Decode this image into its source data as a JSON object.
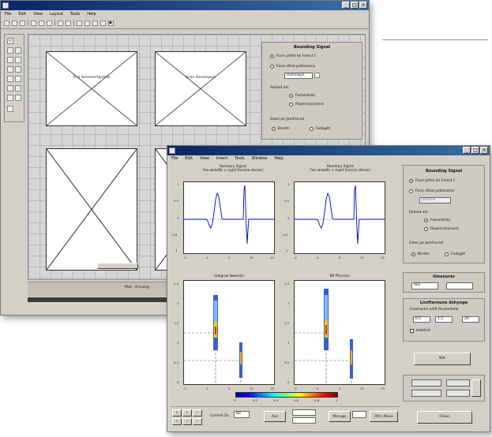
{
  "guide": {
    "window_title": "",
    "menu": [
      "File",
      "Edit",
      "View",
      "Layout",
      "Tools",
      "Help"
    ],
    "axes": [
      {
        "label": "Frst Scheme/Update"
      },
      {
        "label": "Scen Sonsarpe/s"
      },
      {
        "label": ""
      },
      {
        "label": ""
      }
    ],
    "panel": {
      "title": "Bounding Signal",
      "opt1": "Fone pitfot tei Femct f",
      "opt2": "Fone sltrot pstheroms",
      "edit": "Hutmiepit",
      "section": "Reload ein",
      "opt3": "Fomerdrsts",
      "opt4": "Repennaroment",
      "section2": "Gden pe Jemfrecnd",
      "opt5": "Bredm",
      "opt6": "Fedoght"
    },
    "status": "Mat - Arccong"
  },
  "fig": {
    "window_title": "",
    "menu": [
      "File",
      "Edit",
      "View",
      "Insert",
      "Tools",
      "Window",
      "Help"
    ],
    "plots": [
      {
        "title": "Ronntary Signal",
        "subtitle": "Fee oIntaffe + mplit Fecv(m sferrer)",
        "xticks": [
          "-5",
          "0",
          "5",
          "10",
          "15"
        ],
        "yticks": [
          "1",
          "0.5",
          "0",
          "-0.5",
          "-1"
        ]
      },
      {
        "title": "Ronntary Signal",
        "subtitle": "Fee oIntaffe + mplit Fecv(m sferrer)",
        "xticks": [
          "-5",
          "0",
          "5",
          "10",
          "15"
        ],
        "yticks": [
          "1",
          "0.5",
          "0",
          "-0.5",
          "-1"
        ]
      },
      {
        "title": "Udegrae Neerotie",
        "xticks": [
          "-5",
          "0",
          "5",
          "10",
          "15"
        ],
        "yticks": [
          "2.5",
          "2",
          "1.5",
          "1",
          "0.5",
          "0"
        ]
      },
      {
        "title": "Bfl Pfcersnt",
        "xticks": [
          "-5",
          "0",
          "5",
          "10",
          "15"
        ],
        "yticks": [
          "2.5",
          "2",
          "1.5",
          "1",
          "0.5",
          "0"
        ]
      }
    ],
    "colorbar_ticks": [
      "0",
      "0.2",
      "0.4",
      "0.6",
      "0.8",
      "1"
    ],
    "panel": {
      "title": "Bounding Signal",
      "opt1": "Fone pitfot tei Femct f",
      "opt2": "Fone sltrot pstheroms",
      "edit": "Dehmer",
      "section": "Reload ein",
      "opt3": "Fomerdrsts",
      "opt4": "Repennaroment",
      "section2": "Gden pe Jemfrecnd",
      "opt5": "Bredm",
      "opt6": "Fedoght",
      "frame2_title": "Umenurer",
      "f2_val1": "Aks",
      "f2_val2": "",
      "frame3_title": "Lnnfteroune dshynge",
      "f3_label": "Contractrs selft Rnomelahe",
      "f3_a": "0.5",
      "f3_b": "1.5",
      "f3_c": "20",
      "f3_chk": "Hotdnst",
      "run_label": "Nat",
      "close_label": "Ctoun"
    },
    "bottom": {
      "zoom": "Contrul Za",
      "btn1": "Aas",
      "btn2": "Menugs",
      "btn3": "Rflrn Noun",
      "field": "80"
    }
  }
}
